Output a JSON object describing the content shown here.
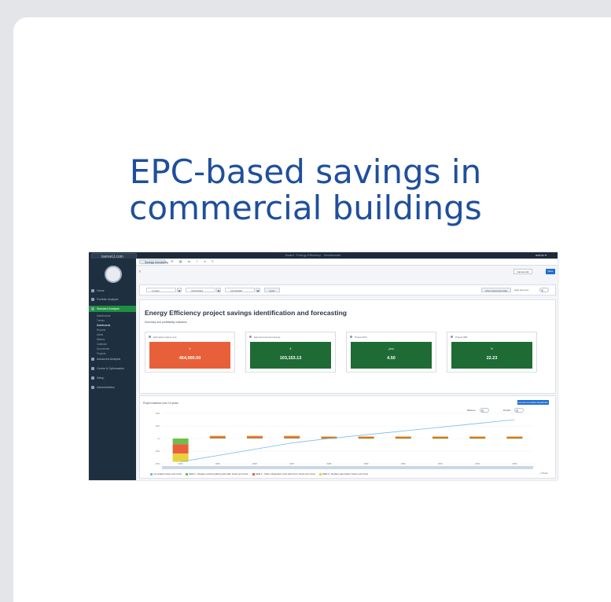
{
  "card": {
    "headline_line1": "EPC-based savings in",
    "headline_line2": "commercial buildings"
  },
  "app": {
    "brand": "iserveU.com",
    "window_title": "Board · Energy Efficiency · Dashboards",
    "user": "admin ▾",
    "accent_color": "#1d8f3f",
    "sidebar_color": "#1e2f40"
  },
  "sidebar": {
    "items": [
      {
        "label": "Home",
        "icon": "home-icon"
      },
      {
        "label": "Portfolio Analysis",
        "icon": "chart-icon"
      },
      {
        "label": "Standard Analysis",
        "icon": "grid-icon",
        "active": true
      },
      {
        "label": "Advanced Analysis",
        "icon": "gear-icon"
      },
      {
        "label": "Centre & Optimization",
        "icon": "sliders-icon"
      },
      {
        "label": "Setup",
        "icon": "wrench-icon"
      },
      {
        "label": "Administration",
        "icon": "user-icon"
      }
    ],
    "sub_items": [
      "Dashboards",
      "Trends",
      "Dashboards",
      "Reports",
      "Alerts",
      "Metrics",
      "Calendar",
      "Documents",
      "Projects"
    ]
  },
  "toolbar": {
    "tab_label": "Savings forecasting",
    "tab_icons": "⚙ ▦ ⇆ ⇪ ▾ ✎",
    "back_icon": "‹",
    "cancel_label": "Cancel edit",
    "save_label": "Save"
  },
  "filters": {
    "building": "6 years",
    "date_from": "01/01/2024",
    "date_to": "31/12/2029",
    "apply_label": "Apply",
    "advanced_label": "Show advanced data",
    "help_label": "Help text (on)"
  },
  "dashboard": {
    "title": "Energy Efficiency project savings identification and forecasting",
    "subtitle": "Summary and profitability indicators",
    "kpis": [
      {
        "label": "Estimated project cost",
        "unit": "€",
        "value": "464,000.00",
        "color": "#e8603a"
      },
      {
        "label": "Expected annual savings",
        "unit": "€",
        "value": "103,153.13",
        "color": "#1f6b35"
      },
      {
        "label": "Project ROI",
        "unit": "year",
        "value": "4.50",
        "color": "#1f6b35"
      },
      {
        "label": "Project IRR",
        "unit": "%",
        "value": "22.23",
        "color": "#1f6b35"
      }
    ]
  },
  "projection": {
    "title": "Project balance over 10 years",
    "buttons": "Annual   Cumulative   Breakdown",
    "opt1": "Balance",
    "opt2": "Details",
    "legend": [
      {
        "label": "Cumulative Flows and Costs",
        "color": "#7ab8e6"
      },
      {
        "label": "EEM 1 - Replace existing lighting with LED: Flows and Costs",
        "color": "#6cc04a"
      },
      {
        "label": "EEM 2 - Solar refrigeration units with doors: Flows and Costs",
        "color": "#e8603a"
      },
      {
        "label": "EEM 3 - Replace gas boilers: Flows and Costs",
        "color": "#e8d23a"
      }
    ],
    "fullscreen_label": "⤢ Zoom"
  },
  "chart_data": {
    "type": "bar",
    "categories": [
      "2024",
      "2025",
      "2026",
      "2027",
      "2028",
      "2029",
      "2030",
      "2031",
      "2032",
      "2033"
    ],
    "series": [
      {
        "name": "EEM 1 - Replace existing lighting with LED: Flows and Costs",
        "values": [
          -90000,
          8000,
          8000,
          8000,
          6000,
          6000,
          6000,
          6000,
          6000,
          6000
        ]
      },
      {
        "name": "EEM 2 - Solar refrigeration units with doors: Flows and Costs",
        "values": [
          -150000,
          28000,
          28000,
          28000,
          22000,
          22000,
          22000,
          22000,
          22000,
          22000
        ]
      },
      {
        "name": "EEM 3 - Replace gas boilers: Flows and Costs",
        "values": [
          -130000,
          10000,
          10000,
          10000,
          8000,
          8000,
          8000,
          8000,
          8000,
          8000
        ]
      },
      {
        "name": "Cumulative Flows and Costs",
        "values": [
          -370000,
          -270000,
          -170000,
          -70000,
          0,
          60000,
          120000,
          180000,
          240000,
          300000
        ]
      }
    ],
    "ylim": [
      -400000,
      400000
    ]
  }
}
